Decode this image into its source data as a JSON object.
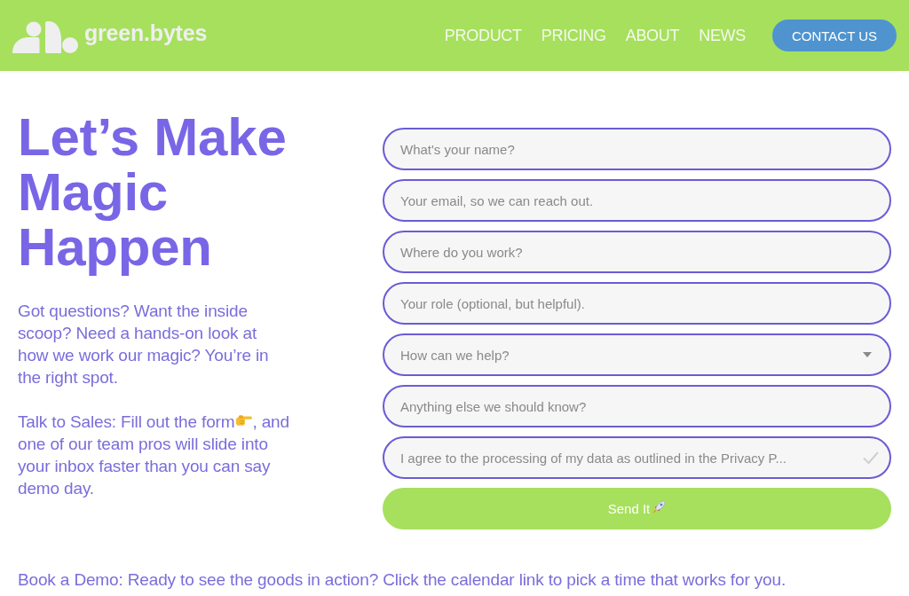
{
  "header": {
    "brand": "green.bytes",
    "nav": [
      "PRODUCT",
      "PRICING",
      "ABOUT",
      "NEWS"
    ],
    "cta": "CONTACT US"
  },
  "hero": {
    "title": "Let’s Make Magic Happen",
    "intro": "Got questions? Want the inside scoop? Need a hands-on look at how we work our magic? You’re in the right spot.",
    "sales_note": {
      "before": "Talk to Sales: Fill out the form",
      "after": ", and one of our team pros will slide into your inbox faster than you can say demo day."
    }
  },
  "form": {
    "fields": [
      {
        "kind": "text",
        "placeholder": "What's your name?"
      },
      {
        "kind": "text",
        "placeholder": "Your email, so we can reach out."
      },
      {
        "kind": "text",
        "placeholder": "Where do you work?"
      },
      {
        "kind": "text",
        "placeholder": "Your role (optional, but helpful)."
      },
      {
        "kind": "select",
        "placeholder": "How can we help?"
      },
      {
        "kind": "text",
        "placeholder": "Anything else we should know?"
      },
      {
        "kind": "checkbox",
        "label": "I agree to the processing of my data as outlined in the Privacy P...",
        "checked": false
      }
    ],
    "submit": "Send It"
  },
  "footer_text": "Book a Demo: Ready to see the goods in action? Click the calendar link to pick a time that works for you."
}
